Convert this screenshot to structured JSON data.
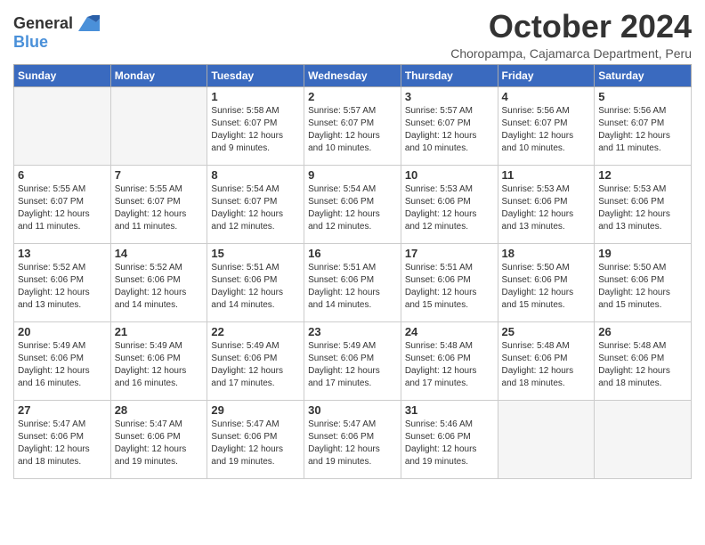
{
  "logo": {
    "general": "General",
    "blue": "Blue"
  },
  "title": "October 2024",
  "location": "Choropampa, Cajamarca Department, Peru",
  "days_of_week": [
    "Sunday",
    "Monday",
    "Tuesday",
    "Wednesday",
    "Thursday",
    "Friday",
    "Saturday"
  ],
  "weeks": [
    [
      {
        "day": "",
        "empty": true
      },
      {
        "day": "",
        "empty": true
      },
      {
        "day": "1",
        "sunrise": "5:58 AM",
        "sunset": "6:07 PM",
        "daylight": "12 hours and 9 minutes."
      },
      {
        "day": "2",
        "sunrise": "5:57 AM",
        "sunset": "6:07 PM",
        "daylight": "12 hours and 10 minutes."
      },
      {
        "day": "3",
        "sunrise": "5:57 AM",
        "sunset": "6:07 PM",
        "daylight": "12 hours and 10 minutes."
      },
      {
        "day": "4",
        "sunrise": "5:56 AM",
        "sunset": "6:07 PM",
        "daylight": "12 hours and 10 minutes."
      },
      {
        "day": "5",
        "sunrise": "5:56 AM",
        "sunset": "6:07 PM",
        "daylight": "12 hours and 11 minutes."
      }
    ],
    [
      {
        "day": "6",
        "sunrise": "5:55 AM",
        "sunset": "6:07 PM",
        "daylight": "12 hours and 11 minutes."
      },
      {
        "day": "7",
        "sunrise": "5:55 AM",
        "sunset": "6:07 PM",
        "daylight": "12 hours and 11 minutes."
      },
      {
        "day": "8",
        "sunrise": "5:54 AM",
        "sunset": "6:07 PM",
        "daylight": "12 hours and 12 minutes."
      },
      {
        "day": "9",
        "sunrise": "5:54 AM",
        "sunset": "6:06 PM",
        "daylight": "12 hours and 12 minutes."
      },
      {
        "day": "10",
        "sunrise": "5:53 AM",
        "sunset": "6:06 PM",
        "daylight": "12 hours and 12 minutes."
      },
      {
        "day": "11",
        "sunrise": "5:53 AM",
        "sunset": "6:06 PM",
        "daylight": "12 hours and 13 minutes."
      },
      {
        "day": "12",
        "sunrise": "5:53 AM",
        "sunset": "6:06 PM",
        "daylight": "12 hours and 13 minutes."
      }
    ],
    [
      {
        "day": "13",
        "sunrise": "5:52 AM",
        "sunset": "6:06 PM",
        "daylight": "12 hours and 13 minutes."
      },
      {
        "day": "14",
        "sunrise": "5:52 AM",
        "sunset": "6:06 PM",
        "daylight": "12 hours and 14 minutes."
      },
      {
        "day": "15",
        "sunrise": "5:51 AM",
        "sunset": "6:06 PM",
        "daylight": "12 hours and 14 minutes."
      },
      {
        "day": "16",
        "sunrise": "5:51 AM",
        "sunset": "6:06 PM",
        "daylight": "12 hours and 14 minutes."
      },
      {
        "day": "17",
        "sunrise": "5:51 AM",
        "sunset": "6:06 PM",
        "daylight": "12 hours and 15 minutes."
      },
      {
        "day": "18",
        "sunrise": "5:50 AM",
        "sunset": "6:06 PM",
        "daylight": "12 hours and 15 minutes."
      },
      {
        "day": "19",
        "sunrise": "5:50 AM",
        "sunset": "6:06 PM",
        "daylight": "12 hours and 15 minutes."
      }
    ],
    [
      {
        "day": "20",
        "sunrise": "5:49 AM",
        "sunset": "6:06 PM",
        "daylight": "12 hours and 16 minutes."
      },
      {
        "day": "21",
        "sunrise": "5:49 AM",
        "sunset": "6:06 PM",
        "daylight": "12 hours and 16 minutes."
      },
      {
        "day": "22",
        "sunrise": "5:49 AM",
        "sunset": "6:06 PM",
        "daylight": "12 hours and 17 minutes."
      },
      {
        "day": "23",
        "sunrise": "5:49 AM",
        "sunset": "6:06 PM",
        "daylight": "12 hours and 17 minutes."
      },
      {
        "day": "24",
        "sunrise": "5:48 AM",
        "sunset": "6:06 PM",
        "daylight": "12 hours and 17 minutes."
      },
      {
        "day": "25",
        "sunrise": "5:48 AM",
        "sunset": "6:06 PM",
        "daylight": "12 hours and 18 minutes."
      },
      {
        "day": "26",
        "sunrise": "5:48 AM",
        "sunset": "6:06 PM",
        "daylight": "12 hours and 18 minutes."
      }
    ],
    [
      {
        "day": "27",
        "sunrise": "5:47 AM",
        "sunset": "6:06 PM",
        "daylight": "12 hours and 18 minutes."
      },
      {
        "day": "28",
        "sunrise": "5:47 AM",
        "sunset": "6:06 PM",
        "daylight": "12 hours and 19 minutes."
      },
      {
        "day": "29",
        "sunrise": "5:47 AM",
        "sunset": "6:06 PM",
        "daylight": "12 hours and 19 minutes."
      },
      {
        "day": "30",
        "sunrise": "5:47 AM",
        "sunset": "6:06 PM",
        "daylight": "12 hours and 19 minutes."
      },
      {
        "day": "31",
        "sunrise": "5:46 AM",
        "sunset": "6:06 PM",
        "daylight": "12 hours and 19 minutes."
      },
      {
        "day": "",
        "empty": true
      },
      {
        "day": "",
        "empty": true
      }
    ]
  ]
}
